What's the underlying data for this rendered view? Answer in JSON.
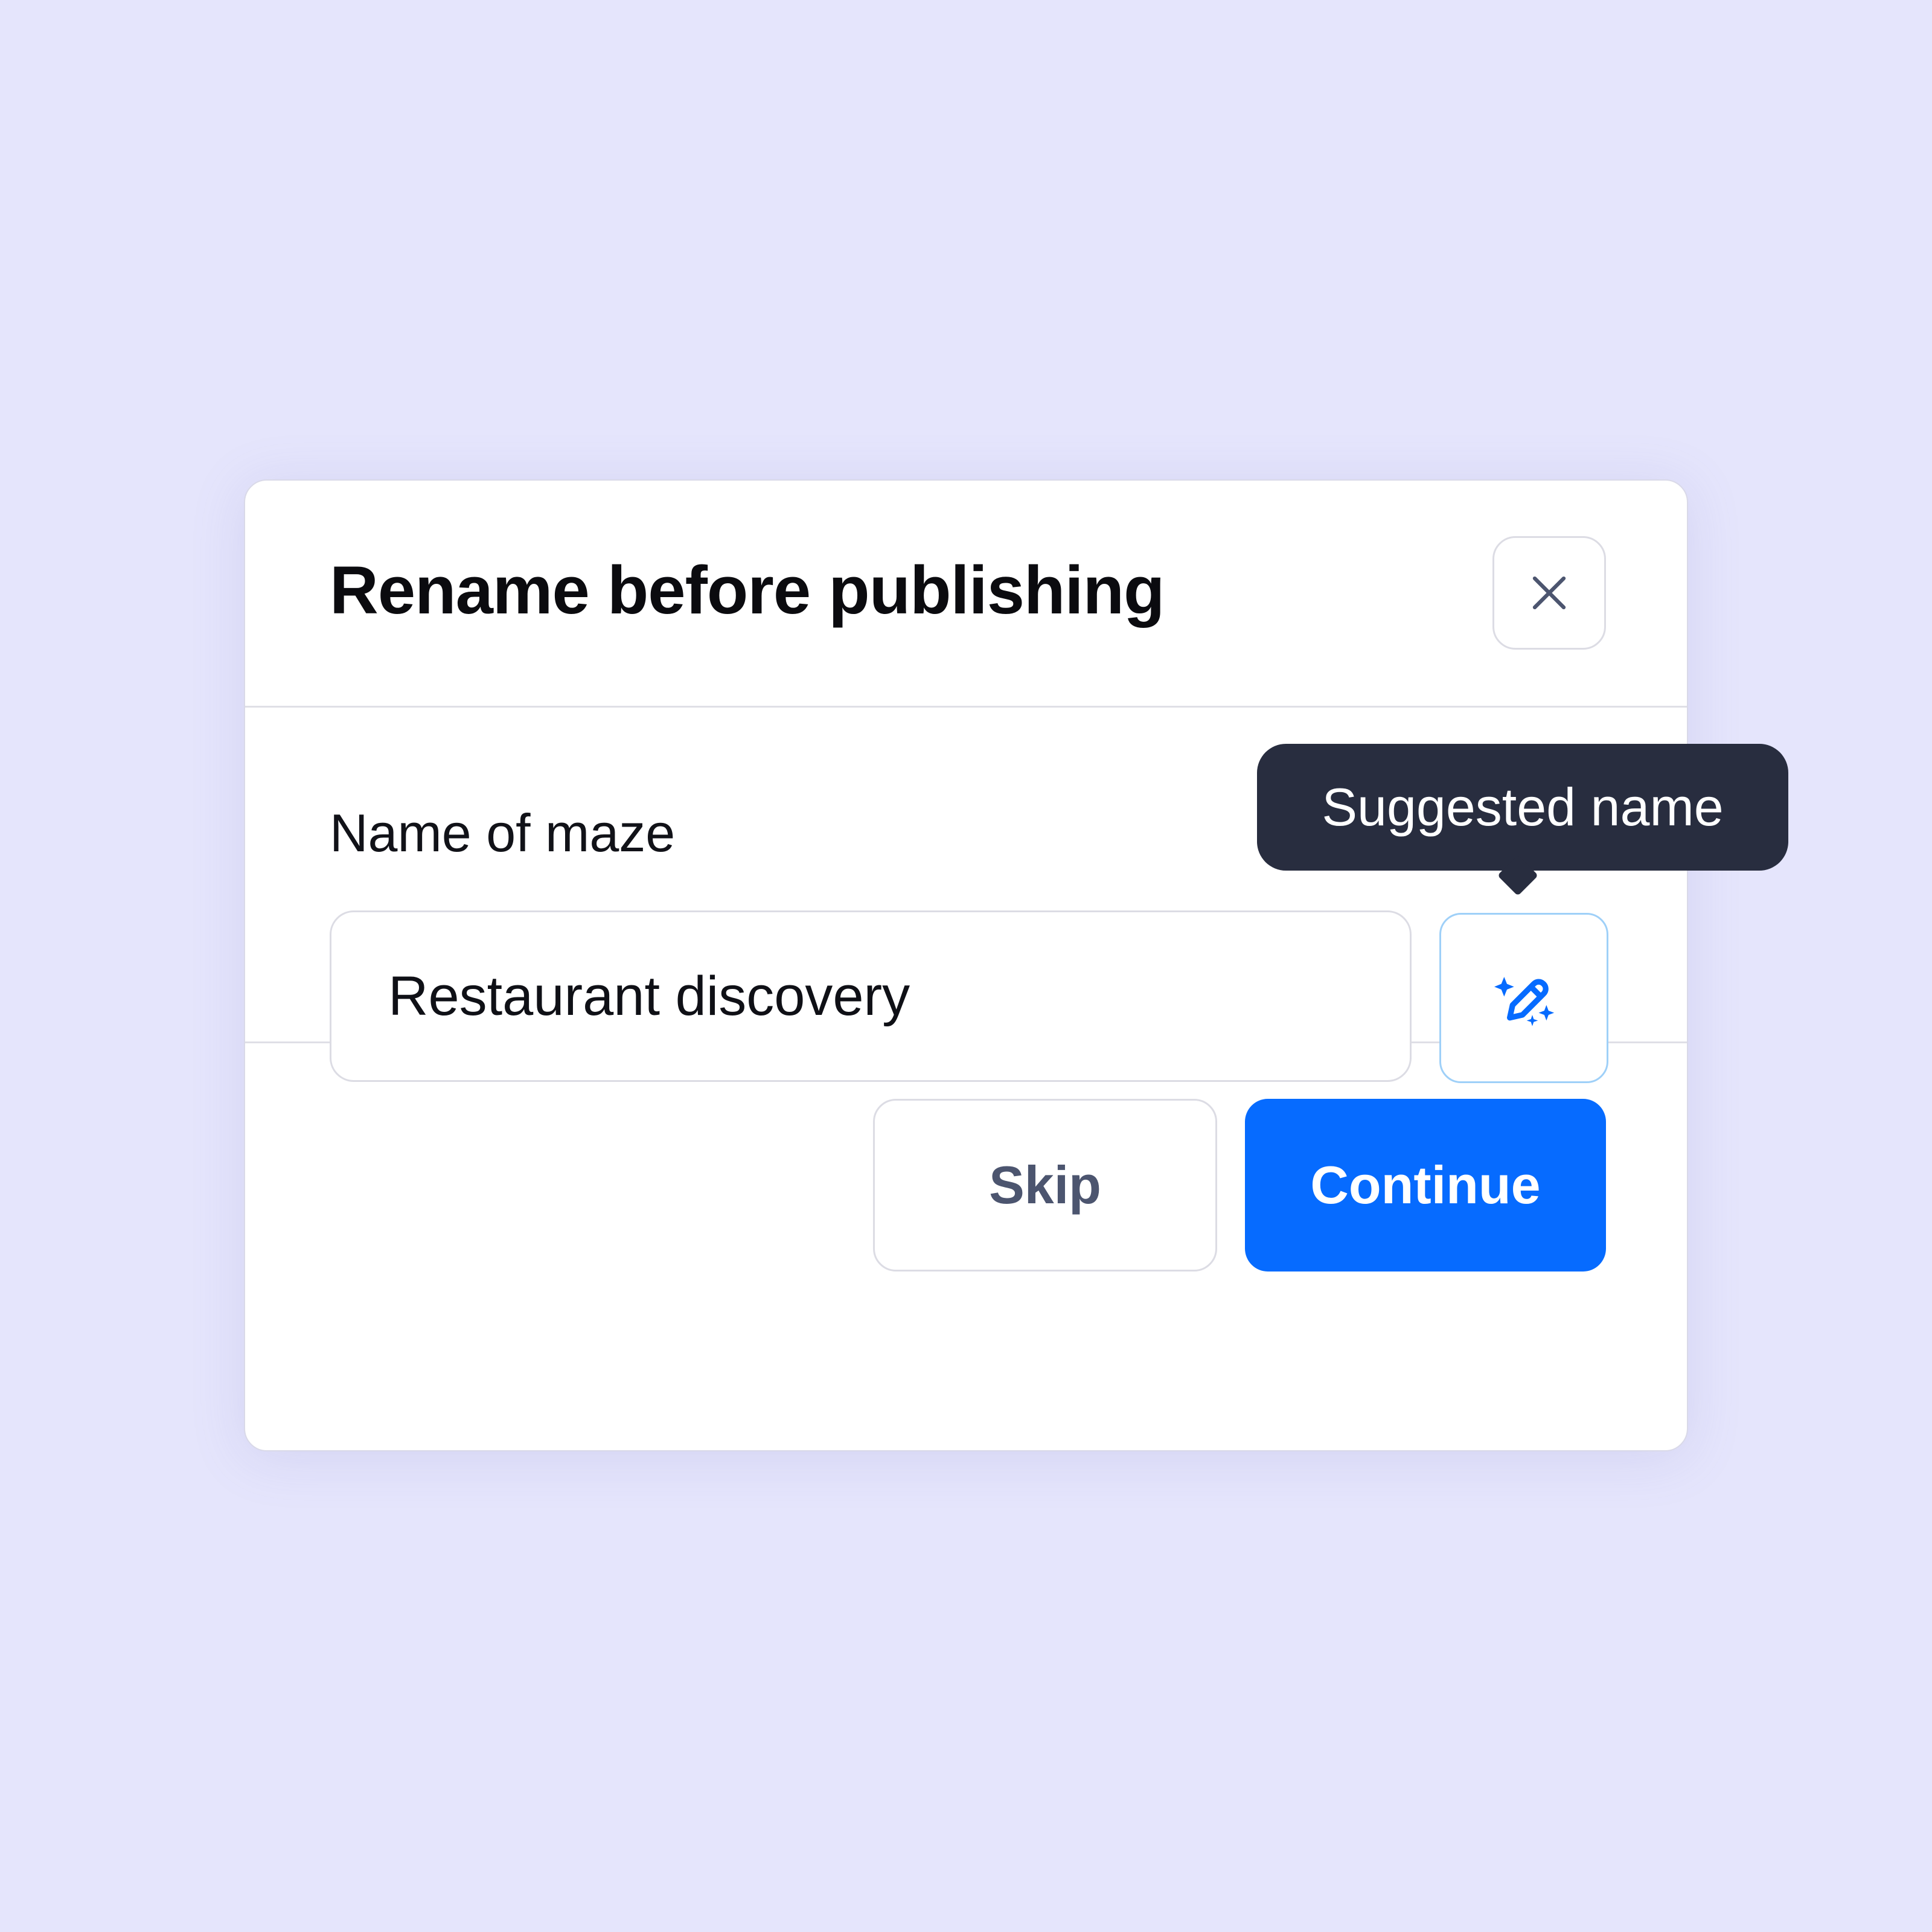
{
  "dialog": {
    "title": "Rename before publishing",
    "close_icon": "close-icon"
  },
  "field": {
    "label": "Name of maze",
    "value": "Restaurant discovery"
  },
  "suggestion": {
    "tooltip": "Suggested name",
    "icon": "magic-pencil-icon"
  },
  "actions": {
    "skip_label": "Skip",
    "continue_label": "Continue"
  },
  "colors": {
    "background": "#e5e5fc",
    "primary": "#066bff",
    "tooltip": "#282d3f",
    "secondary_text": "#4c556f"
  }
}
